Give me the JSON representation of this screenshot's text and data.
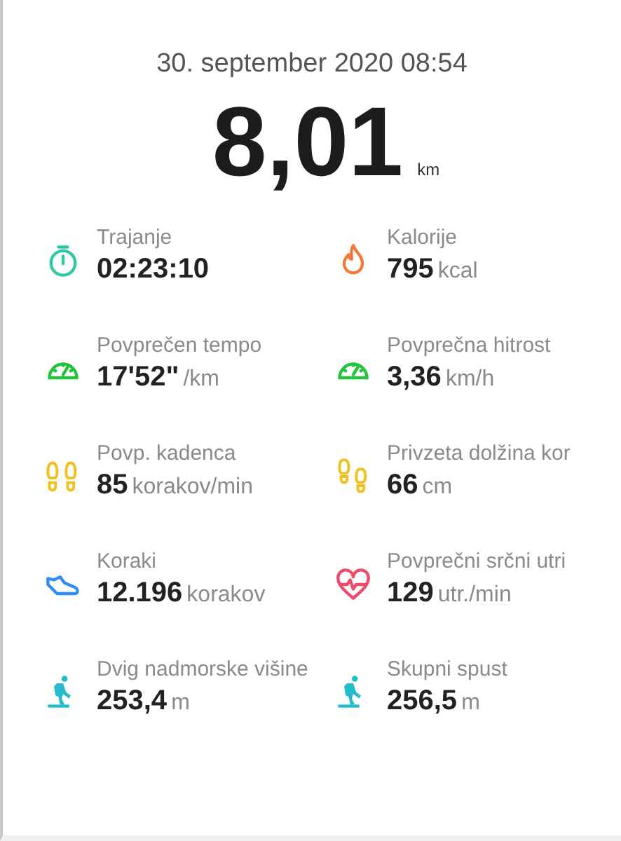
{
  "header": {
    "datetime": "30. september 2020 08:54",
    "distance": "8,01",
    "distance_unit": "km"
  },
  "metrics": [
    {
      "label": "Trajanje",
      "value": "02:23:10",
      "kind": "stopwatch",
      "color": "#2ec9a4"
    },
    {
      "label": "Kalorije",
      "value": "795",
      "unit": "kcal",
      "kind": "flame",
      "color": "#f07a3a"
    },
    {
      "label": "Povprečen tempo",
      "value": "17'52\"",
      "unit": "/km",
      "kind": "gauge",
      "color": "#22c43a"
    },
    {
      "label": "Povprečna hitrost",
      "value": "3,36",
      "unit": "km/h",
      "kind": "gauge",
      "color": "#22c43a"
    },
    {
      "label": "Povp. kadenca",
      "value": "85",
      "unit": "korakov/min",
      "kind": "footprints",
      "color": "#f2c01e"
    },
    {
      "label": "Privzeta dolžina kor",
      "value": "66",
      "unit": "cm",
      "kind": "stride",
      "color": "#f2c01e"
    },
    {
      "label": "Koraki",
      "value": "12.196",
      "unit": "korakov",
      "kind": "shoe",
      "color": "#2f8ef0"
    },
    {
      "label": "Povprečni srčni utri",
      "value": "129",
      "unit": "utr./min",
      "kind": "heart",
      "color": "#ef4a6a"
    },
    {
      "label": "Dvig nadmorske višine",
      "value": "253,4",
      "unit": "m",
      "kind": "hiker",
      "color": "#22bccc"
    },
    {
      "label": "Skupni spust",
      "value": "256,5",
      "unit": "m",
      "kind": "hiker",
      "color": "#22bccc"
    }
  ]
}
